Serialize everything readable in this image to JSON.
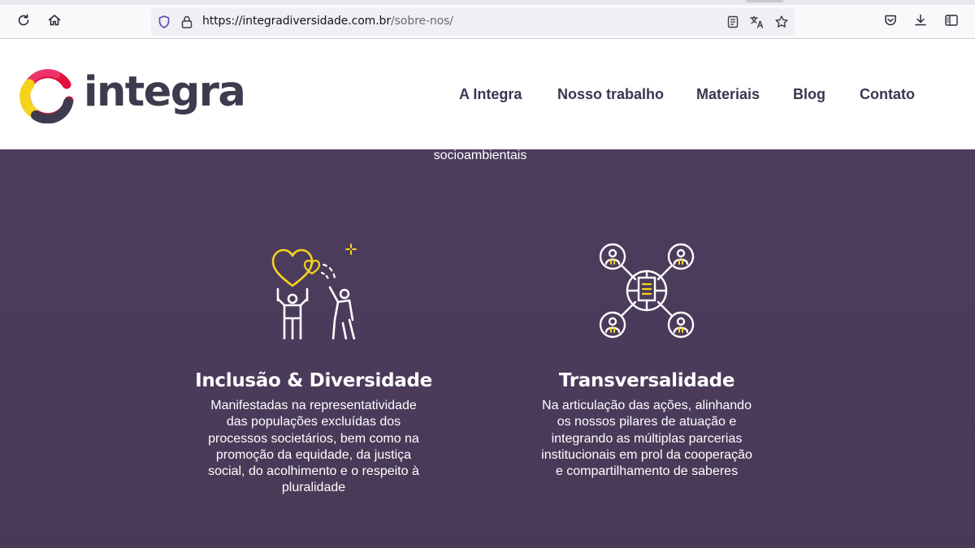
{
  "browser": {
    "url_host": "https://integradiversidade.com.br",
    "url_path": "/sobre-nos/"
  },
  "brand": {
    "name": "integra",
    "colors": {
      "primary": "#3f3a4d",
      "accent_yellow": "#f5d31c",
      "accent_red": "#e2103b",
      "background": "#4a3a5a"
    }
  },
  "nav": {
    "items": [
      {
        "label": "A Integra"
      },
      {
        "label": "Nosso trabalho"
      },
      {
        "label": "Materiais"
      },
      {
        "label": "Blog"
      },
      {
        "label": "Contato"
      }
    ]
  },
  "intro": {
    "tail_text": "socioambientais"
  },
  "pillars": [
    {
      "icon": "heart-people-icon",
      "title": "Inclusão & Diversidade",
      "text": "Manifestadas na representatividade das populações excluídas dos processos societários, bem como na promoção da equidade, da justiça social, do acolhimento e o respeito à pluralidade"
    },
    {
      "icon": "network-people-icon",
      "title": "Transversalidade",
      "text": "Na articulação das ações, alinhando os nossos pilares de atuação e integrando as múltiplas parcerias institucionais em prol da cooperação e compartilhamento de saberes"
    }
  ]
}
